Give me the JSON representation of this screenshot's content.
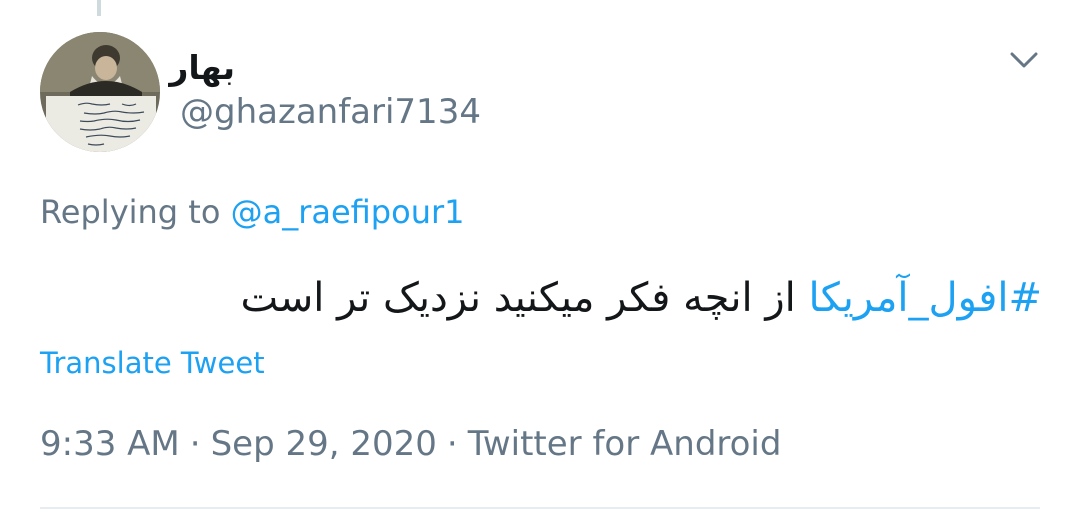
{
  "tweet": {
    "display_name": "بهار",
    "handle": "@ghazanfari7134",
    "replying_prefix": "Replying to",
    "replying_mention": "@a_raefipour1",
    "hashtag": "#افول_آمریکا",
    "body_text": "از انچه فکر میکنید نزدیک تر است",
    "translate_label": "Translate Tweet",
    "time": "9:33 AM",
    "separator": "·",
    "date": "Sep 29, 2020",
    "source": "Twitter for Android"
  },
  "icons": {
    "menu": "chevron-down-icon",
    "avatar": "profile-avatar"
  },
  "colors": {
    "link": "#1da1f2",
    "secondary_text": "#657786",
    "primary_text": "#14171a",
    "divider": "#e6ecf0"
  }
}
